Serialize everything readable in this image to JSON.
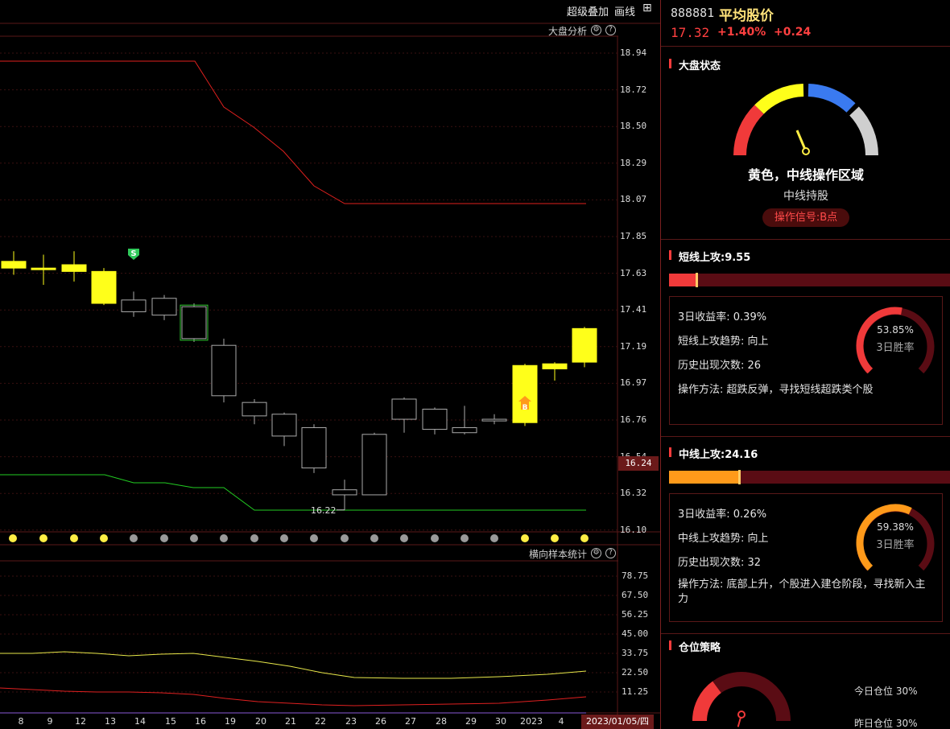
{
  "toolbar": {
    "overlay_label": "超级叠加",
    "draw_label": "画线"
  },
  "main_chart": {
    "title": "大盘分析",
    "price_levels": [
      "18.94",
      "18.72",
      "18.50",
      "18.29",
      "18.07",
      "17.85",
      "17.63",
      "17.41",
      "17.19",
      "16.97",
      "16.76",
      "16.54",
      "16.32",
      "16.10"
    ],
    "current_price_tag": "16.24",
    "low_marker_label": "16.22",
    "sell_marker": "S",
    "buy_marker": "B",
    "candles": [
      {
        "o": 17.66,
        "c": 17.7,
        "h": 17.76,
        "l": 17.62,
        "color": "yellow"
      },
      {
        "o": 17.66,
        "c": 17.66,
        "h": 17.74,
        "l": 17.56,
        "color": "yellow"
      },
      {
        "o": 17.64,
        "c": 17.68,
        "h": 17.76,
        "l": 17.58,
        "color": "yellow"
      },
      {
        "o": 17.64,
        "c": 17.45,
        "h": 17.66,
        "l": 17.44,
        "color": "yellow"
      },
      {
        "o": 17.4,
        "c": 17.47,
        "h": 17.52,
        "l": 17.37,
        "color": "hollow"
      },
      {
        "o": 17.38,
        "c": 17.48,
        "h": 17.5,
        "l": 17.35,
        "color": "hollow"
      },
      {
        "o": 17.24,
        "c": 17.43,
        "h": 17.45,
        "l": 17.22,
        "color": "hollow",
        "box": true
      },
      {
        "o": 16.9,
        "c": 17.2,
        "h": 17.24,
        "l": 16.86,
        "color": "hollow"
      },
      {
        "o": 16.78,
        "c": 16.86,
        "h": 16.88,
        "l": 16.73,
        "color": "hollow"
      },
      {
        "o": 16.66,
        "c": 16.79,
        "h": 16.8,
        "l": 16.6,
        "color": "hollow"
      },
      {
        "o": 16.47,
        "c": 16.71,
        "h": 16.73,
        "l": 16.44,
        "color": "hollow"
      },
      {
        "o": 16.31,
        "c": 16.34,
        "h": 16.4,
        "l": 16.22,
        "color": "hollow"
      },
      {
        "o": 16.31,
        "c": 16.67,
        "h": 16.68,
        "l": 16.31,
        "color": "hollow"
      },
      {
        "o": 16.76,
        "c": 16.88,
        "h": 16.89,
        "l": 16.68,
        "color": "hollow"
      },
      {
        "o": 16.7,
        "c": 16.82,
        "h": 16.83,
        "l": 16.67,
        "color": "hollow"
      },
      {
        "o": 16.68,
        "c": 16.71,
        "h": 16.84,
        "l": 16.67,
        "color": "hollow"
      },
      {
        "o": 16.75,
        "c": 16.76,
        "h": 16.79,
        "l": 16.73,
        "color": "hollow"
      },
      {
        "o": 16.74,
        "c": 17.08,
        "h": 17.09,
        "l": 16.72,
        "color": "yellow"
      },
      {
        "o": 17.06,
        "c": 17.09,
        "h": 17.1,
        "l": 16.99,
        "color": "yellow"
      },
      {
        "o": 17.1,
        "c": 17.3,
        "h": 17.31,
        "l": 17.07,
        "color": "yellow"
      }
    ],
    "dates": [
      "8",
      "9",
      "12",
      "13",
      "14",
      "15",
      "16",
      "19",
      "20",
      "21",
      "22",
      "23",
      "26",
      "27",
      "28",
      "29",
      "30",
      "2023",
      "4"
    ],
    "signal_dots": [
      "yellow",
      "yellow",
      "yellow",
      "yellow",
      "gray",
      "gray",
      "gray",
      "gray",
      "gray",
      "gray",
      "gray",
      "gray",
      "gray",
      "gray",
      "gray",
      "gray",
      "gray",
      "yellow",
      "yellow",
      "yellow"
    ]
  },
  "oscillator": {
    "title": "横向样本统计",
    "levels": [
      "78.75",
      "67.50",
      "56.25",
      "45.00",
      "33.75",
      "22.50",
      "11.25"
    ]
  },
  "date_tag": "2023/01/05/四",
  "side": {
    "code": "888881",
    "name": "平均股价",
    "price": "17.32",
    "change_pct": "+1.40%",
    "change": "+0.24",
    "market_state": {
      "title": "大盘状态",
      "status": "黄色，中线操作区域",
      "advice": "中线持股",
      "signal": "操作信号:B点"
    },
    "short_attack": {
      "title": "短线上攻:9.55",
      "bar_level": 0.1,
      "yield": "3日收益率: 0.39%",
      "trend": "短线上攻趋势: 向上",
      "count": "历史出现次数: 26",
      "method": "操作方法: 超跌反弹，寻找短线超跌类个股",
      "win_rate": "53.85%",
      "win_label": "3日胜率",
      "win_value": 0.5385
    },
    "mid_attack": {
      "title": "中线上攻:24.16",
      "bar_level": 0.25,
      "yield": "3日收益率: 0.26%",
      "trend": "中线上攻趋势: 向上",
      "count": "历史出现次数: 32",
      "method": "操作方法: 底部上升，个股进入建仓阶段，寻找新入主力",
      "win_rate": "59.38%",
      "win_label": "3日胜率",
      "win_value": 0.5938
    },
    "position": {
      "title": "仓位策略",
      "today": "今日仓位  30%",
      "yesterday": "昨日仓位  30%",
      "level": 0.3
    }
  }
}
